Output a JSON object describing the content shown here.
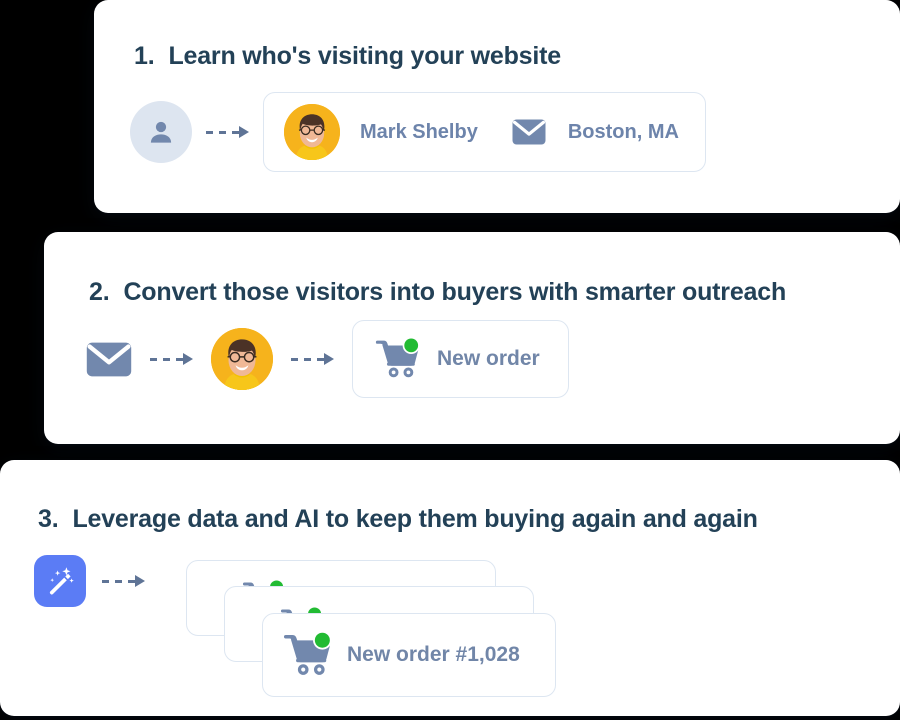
{
  "steps": [
    {
      "number": "1.",
      "title": "Learn who's visiting your website",
      "visitor_icon": "anonymous-person-icon",
      "arrow_icon": "dashed-arrow-right-icon",
      "person": {
        "avatar_icon": "person-photo-avatar",
        "name": "Mark Shelby",
        "mail_icon": "envelope-icon",
        "location": "Boston, MA"
      }
    },
    {
      "number": "2.",
      "title": "Convert those visitors into buyers with smarter outreach",
      "mail_icon": "envelope-icon",
      "arrow_icon": "dashed-arrow-right-icon",
      "avatar_icon": "person-photo-avatar",
      "order": {
        "cart_icon": "shopping-cart-icon",
        "badge_icon": "green-dot-badge",
        "label": "New order"
      }
    },
    {
      "number": "3.",
      "title": "Leverage data and AI to keep them buying again and again",
      "wand_icon": "magic-wand-icon",
      "arrow_icon": "dashed-arrow-right-icon",
      "orders": {
        "cart_icon": "shopping-cart-icon",
        "badge_icon": "green-dot-badge",
        "label": "New order #1,028"
      }
    }
  ],
  "colors": {
    "heading": "#234157",
    "muted_text": "#6d84ab",
    "slate_icon": "#7288ad",
    "anon_bg": "#dde5f0",
    "card_border": "#dde6f1",
    "badge_green": "#22bb33",
    "wand_tile": "#5b7cf5",
    "avatar_yellow": "#f6b31c",
    "arrow": "#5f7496"
  }
}
